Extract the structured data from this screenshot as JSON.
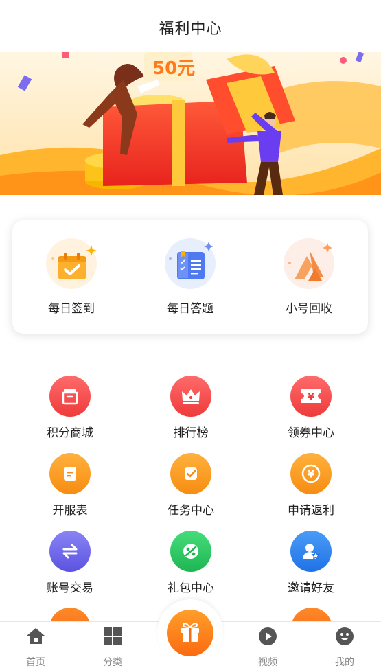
{
  "header": {
    "title": "福利中心"
  },
  "banner": {
    "coupon_text": "50元"
  },
  "quick": [
    {
      "label": "每日签到",
      "icon": "calendar-check-icon"
    },
    {
      "label": "每日答题",
      "icon": "answer-book-icon"
    },
    {
      "label": "小号回收",
      "icon": "recycle-triangle-icon"
    }
  ],
  "grid": [
    {
      "label": "积分商城",
      "icon": "store-icon",
      "color": "#f24d4d"
    },
    {
      "label": "排行榜",
      "icon": "crown-icon",
      "color": "#f24d4d"
    },
    {
      "label": "领券中心",
      "icon": "yuan-ticket-icon",
      "color": "#f24d4d"
    },
    {
      "label": "开服表",
      "icon": "document-icon",
      "color": "#fb9a1e"
    },
    {
      "label": "任务中心",
      "icon": "task-check-icon",
      "color": "#fb9a1e"
    },
    {
      "label": "申请返利",
      "icon": "yuan-coin-icon",
      "color": "#fb9a1e"
    },
    {
      "label": "账号交易",
      "icon": "exchange-arrows-icon",
      "color": "#6d66e8"
    },
    {
      "label": "礼包中心",
      "icon": "gift-pack-icon",
      "color": "#2ecc62"
    },
    {
      "label": "邀请好友",
      "icon": "invite-user-icon",
      "color": "#2f86f0"
    }
  ],
  "tabbar": {
    "items": [
      {
        "label": "首页",
        "icon": "home-icon"
      },
      {
        "label": "分类",
        "icon": "category-grid-icon"
      },
      {
        "label": "视频",
        "icon": "video-play-icon"
      },
      {
        "label": "我的",
        "icon": "profile-face-icon"
      }
    ],
    "center_icon": "gift-icon"
  }
}
